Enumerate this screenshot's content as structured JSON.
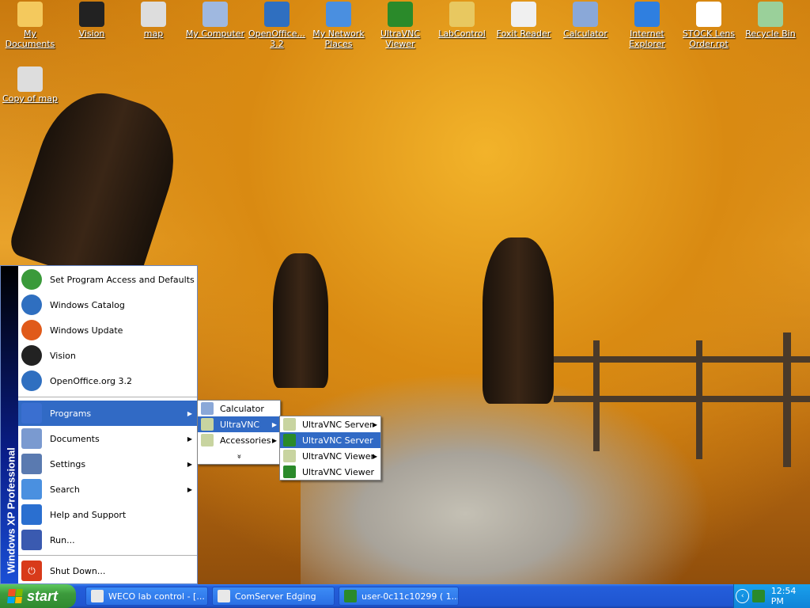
{
  "desktop": {
    "icons": [
      {
        "label": "My Documents",
        "icon": "my-documents-icon",
        "color": "#f4c95d"
      },
      {
        "label": "Vision",
        "icon": "vision-icon",
        "color": "#222222"
      },
      {
        "label": "map",
        "icon": "map-icon",
        "color": "#dddddd"
      },
      {
        "label": "My Computer",
        "icon": "my-computer-icon",
        "color": "#9fb8e0"
      },
      {
        "label": "OpenOffice... 3.2",
        "icon": "openoffice-icon",
        "color": "#2f6fc0"
      },
      {
        "label": "My Network Places",
        "icon": "network-places-icon",
        "color": "#4a8fe0"
      },
      {
        "label": "UltraVNC Viewer",
        "icon": "ultravnc-viewer-icon",
        "color": "#2a8a2a"
      },
      {
        "label": "LabControl",
        "icon": "labcontrol-icon",
        "color": "#e8c860"
      },
      {
        "label": "Foxit Reader",
        "icon": "foxit-reader-icon",
        "color": "#f0f0f0"
      },
      {
        "label": "Calculator",
        "icon": "calculator-icon",
        "color": "#8aa8d8"
      },
      {
        "label": "Internet Explorer",
        "icon": "internet-explorer-icon",
        "color": "#2f7fe0"
      },
      {
        "label": "STOCK Lens Order.rpt",
        "icon": "report-file-icon",
        "color": "#ffffff"
      },
      {
        "label": "Recycle Bin",
        "icon": "recycle-bin-icon",
        "color": "#9ad09a"
      }
    ],
    "second_row": [
      {
        "label": "Copy of map",
        "icon": "map-icon",
        "color": "#dddddd"
      }
    ]
  },
  "start_menu": {
    "sidebar_text": "Windows XP Professional",
    "top_items": [
      {
        "label": "Set Program Access and Defaults",
        "icon": "program-access-icon",
        "color": "#3a9a3a"
      },
      {
        "label": "Windows Catalog",
        "icon": "windows-catalog-icon",
        "color": "#2f6fc0"
      },
      {
        "label": "Windows Update",
        "icon": "windows-update-icon",
        "color": "#e05a1a"
      },
      {
        "label": "Vision",
        "icon": "vision-icon",
        "color": "#222222"
      },
      {
        "label": "OpenOffice.org 3.2",
        "icon": "openoffice-icon",
        "color": "#2f6fc0"
      }
    ],
    "main_items": [
      {
        "label": "Programs",
        "icon": "programs-icon",
        "color": "#3a6fd0",
        "arrow": true,
        "selected": true
      },
      {
        "label": "Documents",
        "icon": "documents-icon",
        "color": "#7a9ad0",
        "arrow": true
      },
      {
        "label": "Settings",
        "icon": "settings-icon",
        "color": "#5a7ab0",
        "arrow": true
      },
      {
        "label": "Search",
        "icon": "search-icon",
        "color": "#4a90e0",
        "arrow": true
      },
      {
        "label": "Help and Support",
        "icon": "help-icon",
        "color": "#2a6fd0"
      },
      {
        "label": "Run...",
        "icon": "run-icon",
        "color": "#3a5ab0"
      }
    ],
    "shutdown_label": "Shut Down..."
  },
  "programs_menu": {
    "items": [
      {
        "label": "Calculator",
        "icon": "calculator-icon",
        "color": "#8aa8d8"
      },
      {
        "label": "UltraVNC",
        "icon": "program-group-icon",
        "color": "#c8d4a0",
        "arrow": true,
        "selected": true
      },
      {
        "label": "Accessories",
        "icon": "program-group-icon",
        "color": "#c8d4a0",
        "arrow": true
      }
    ],
    "expand_glyph": "»"
  },
  "ultravnc_menu": {
    "items": [
      {
        "label": "UltraVNC Server",
        "icon": "program-group-icon",
        "color": "#c8d4a0",
        "arrow": true
      },
      {
        "label": "UltraVNC Server",
        "icon": "ultravnc-server-icon",
        "color": "#2a8a2a",
        "selected": true
      },
      {
        "label": "UltraVNC Viewer",
        "icon": "program-group-icon",
        "color": "#c8d4a0",
        "arrow": true
      },
      {
        "label": "UltraVNC Viewer",
        "icon": "ultravnc-viewer-icon",
        "color": "#2a8a2a"
      }
    ]
  },
  "taskbar": {
    "start_label": "start",
    "buttons": [
      {
        "label": "WECO lab control - [...",
        "icon": "weco-app-icon"
      },
      {
        "label": "ComServer Edging",
        "icon": "comserver-icon"
      },
      {
        "label": "user-0c11c10299 ( 1...",
        "icon": "ultravnc-viewer-icon"
      }
    ],
    "clock": "12:54 PM"
  }
}
